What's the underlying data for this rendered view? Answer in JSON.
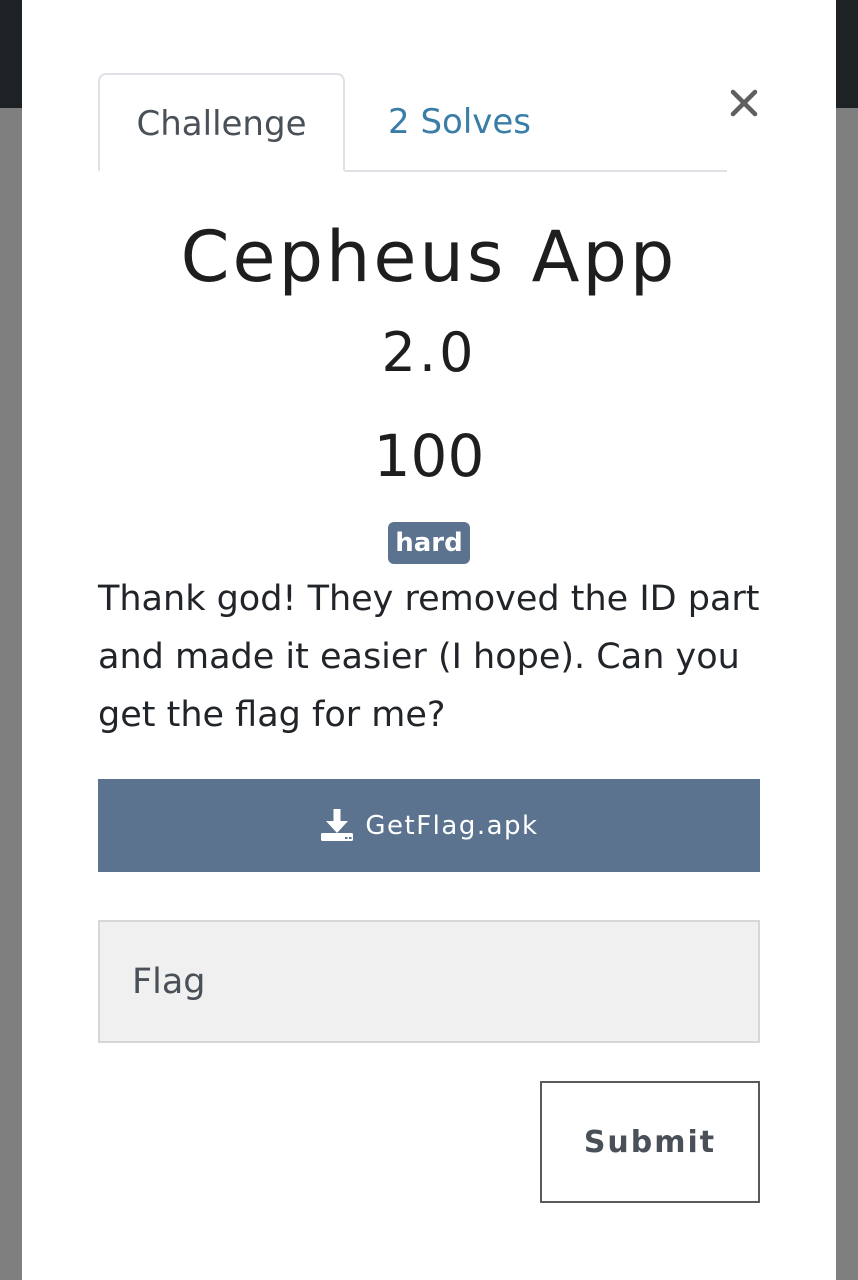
{
  "tabs": [
    {
      "label": "Challenge",
      "active": true
    },
    {
      "label": "2 Solves",
      "active": false
    }
  ],
  "close": {
    "icon": "close-icon",
    "symbol": "×"
  },
  "challenge": {
    "title": "Cepheus App",
    "subtitle": "2.0",
    "points": "100",
    "tag": "hard",
    "description": "Thank god! They removed the ID part and made it easier (I hope). Can you get the flag for me?"
  },
  "download": {
    "icon": "download-icon",
    "label": "GetFlag.apk"
  },
  "flag_input": {
    "placeholder": "Flag",
    "value": ""
  },
  "submit": {
    "label": "Submit"
  },
  "colors": {
    "accent": "#5c7390",
    "link": "#3a7ea8",
    "backdrop": "#7f7f7f",
    "topbar": "#1f2224"
  }
}
